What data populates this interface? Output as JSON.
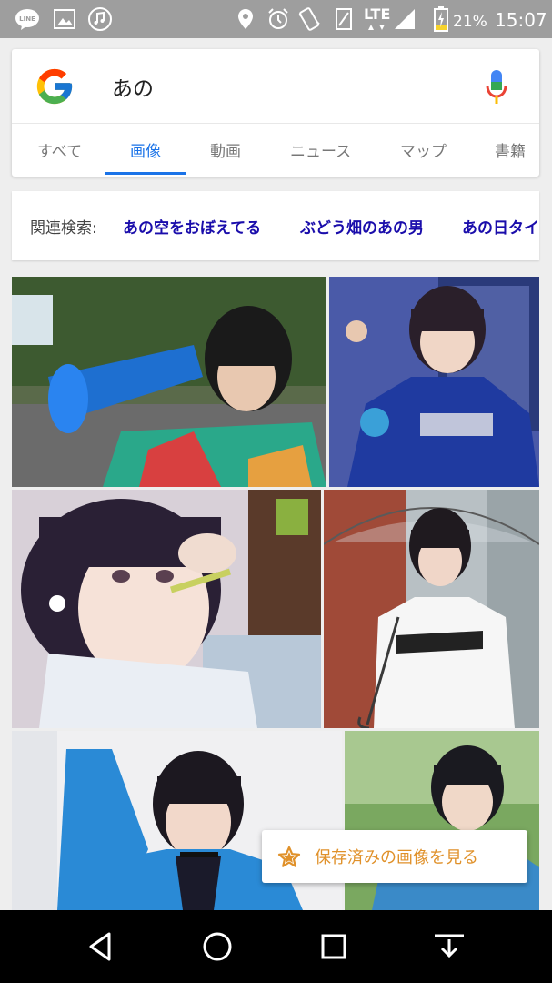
{
  "status_bar": {
    "notification_icons": [
      "line-icon",
      "gallery-icon",
      "music-icon"
    ],
    "system_icons": [
      "location-icon",
      "alarm-icon",
      "vibrate-icon",
      "signal-icon",
      "lte-icon",
      "cell-signal-icon",
      "battery-charging-icon"
    ],
    "network": "LTE",
    "battery": "21%",
    "time": "15:07"
  },
  "search": {
    "query": "あの",
    "mic_icon": "mic-icon"
  },
  "tabs": [
    {
      "label": "すべて",
      "active": false
    },
    {
      "label": "画像",
      "active": true
    },
    {
      "label": "動画",
      "active": false
    },
    {
      "label": "ニュース",
      "active": false
    },
    {
      "label": "マップ",
      "active": false
    },
    {
      "label": "書籍",
      "active": false
    }
  ],
  "related": {
    "label": "関連検索:",
    "items": [
      "あの空をおぼえてる",
      "ぶどう畑のあの男",
      "あの日タイ"
    ]
  },
  "images": [
    {
      "name": "image-girl-megaphone"
    },
    {
      "name": "image-girl-jersey"
    },
    {
      "name": "image-girl-eating"
    },
    {
      "name": "image-girl-umbrella"
    },
    {
      "name": "image-girl-blue-jacket"
    },
    {
      "name": "image-girl-outdoor"
    }
  ],
  "saved_button": {
    "label": "保存済みの画像を見る"
  },
  "nav": {
    "back": "back-icon",
    "home": "home-icon",
    "recents": "recents-icon",
    "download": "download-icon"
  }
}
